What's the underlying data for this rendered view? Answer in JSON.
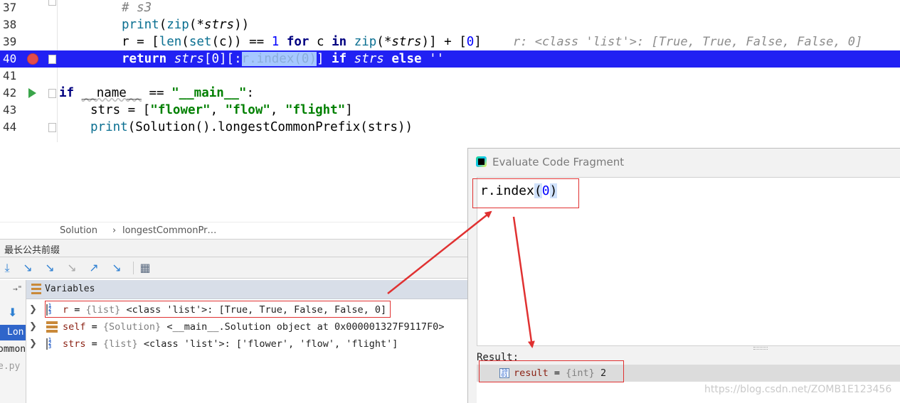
{
  "editor": {
    "lines": [
      {
        "num": "37"
      },
      {
        "num": "38"
      },
      {
        "num": "39"
      },
      {
        "num": "40"
      },
      {
        "num": "41"
      },
      {
        "num": "42"
      },
      {
        "num": "43"
      },
      {
        "num": "44"
      }
    ],
    "l37": {
      "comment": "# s3"
    },
    "l38": {
      "print": "print",
      "open": "(",
      "zip": "zip",
      "args": "(*",
      "strs": "strs",
      "close": "))"
    },
    "l39": {
      "a": "r = [",
      "len": "len",
      "b": "(",
      "set": "set",
      "c": "(c)) == ",
      "one": "1",
      "sp": " ",
      "for": "for",
      "d": " c ",
      "in": "in",
      "e": " ",
      "zip": "zip",
      "f": "(*",
      "strs": "strs",
      "g": ")] + [",
      "zero": "0",
      "h": "]",
      "inline": "r: <class 'list'>: [True, True, False, False, 0]"
    },
    "l40": {
      "ret": "return",
      "sp1": " ",
      "strs": "strs",
      "a": "[0][:",
      "sel": "r.index(0)",
      "b": "] ",
      "if": "if",
      "sp2": " ",
      "strs2": "strs",
      "sp3": " ",
      "else": "else",
      "c": " ''"
    },
    "l42": {
      "if": "if",
      "a": " ",
      "name": "__name__",
      "b": " == ",
      "main": "\"__main__\"",
      "c": ":"
    },
    "l43": {
      "a": "strs = [",
      "s1": "\"flower\"",
      "b": ", ",
      "s2": "\"flow\"",
      "c": ", ",
      "s3": "\"flight\"",
      "d": "]"
    },
    "l44": {
      "print": "print",
      "a": "(Solution().longestCommonPrefix(strs))"
    }
  },
  "breadcrumb": {
    "class": "Solution",
    "sep": "›",
    "method": "longestCommonPr…"
  },
  "debug": {
    "title": "最长公共前缀",
    "toolbar": [
      "step-over",
      "step-into",
      "step-into-my-code",
      "force-step-into",
      "step-out",
      "run-to-cursor",
      "evaluate-expression"
    ],
    "variables_label": "Variables",
    "frames": [
      {
        "label": "Lon",
        "selected": true
      },
      {
        "label": "ommon",
        "selected": false
      },
      {
        "label": "e.py",
        "selected": false
      }
    ],
    "variables": [
      {
        "name": "r",
        "eq": " = ",
        "type": "{list} ",
        "value": "<class 'list'>: [True, True, False, False, 0]",
        "icon": "list-icon"
      },
      {
        "name": "self",
        "eq": " = ",
        "type": "{Solution} ",
        "value": "<__main__.Solution object at 0x000001327F9117F0>",
        "icon": "object-icon"
      },
      {
        "name": "strs",
        "eq": " = ",
        "type": "{list} ",
        "value": "<class 'list'>: ['flower', 'flow', 'flight']",
        "icon": "list-icon"
      }
    ]
  },
  "evaluate": {
    "title": "Evaluate Code Fragment",
    "expr_a": "r.index",
    "expr_open": "(",
    "expr_zero": "0",
    "expr_close": ")",
    "result_label": "Result:",
    "result": {
      "name": "result",
      "eq": " = ",
      "type": "{int} ",
      "value": "2"
    }
  },
  "watermark": "https://blog.csdn.net/ZOMB1E123456",
  "colors": {
    "exec_line": "#2121f3",
    "breakpoint": "#e24b4b",
    "annotation": "#e03131",
    "selected_frame": "#2f65ca"
  }
}
